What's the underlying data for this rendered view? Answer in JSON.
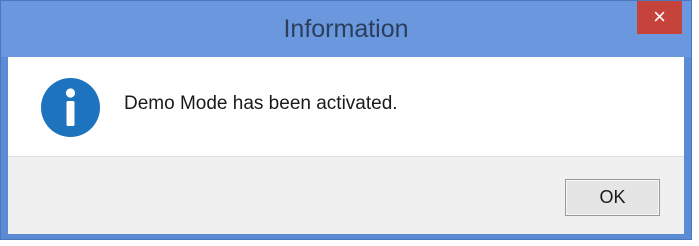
{
  "window": {
    "title": "Information",
    "close_glyph": "×"
  },
  "dialog": {
    "icon": "info-icon",
    "message": "Demo Mode has been activated."
  },
  "buttons": {
    "ok_label": "OK"
  },
  "colors": {
    "frame": "#5b8bd4",
    "titlebar": "#6a97dd",
    "close": "#c6433c",
    "icon": "#1e73be",
    "footer": "#f0f0f0"
  }
}
